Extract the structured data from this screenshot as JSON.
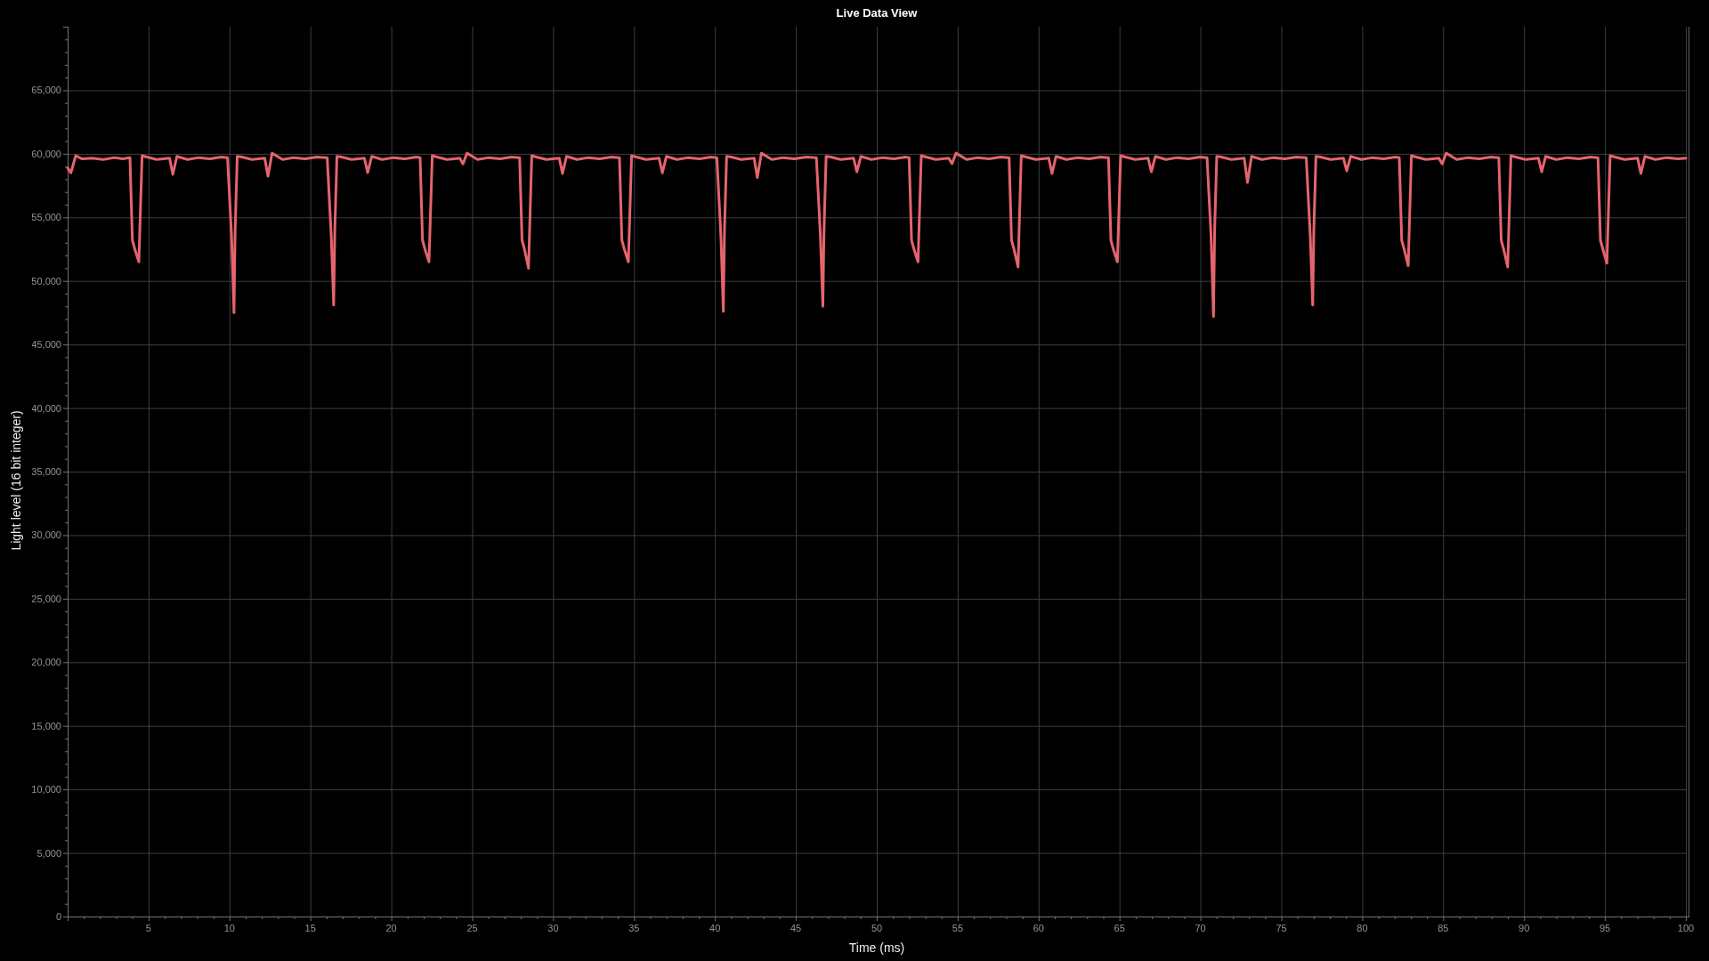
{
  "chart_panel": {
    "chart_data": {
      "type": "line",
      "title": "Live Data View",
      "xlabel": "Time (ms)",
      "ylabel": "Light level (16 bit integer)",
      "grid": true,
      "x": [
        0,
        0.2,
        0.5,
        0.9,
        1.5,
        2.2,
        2.9,
        3.4,
        3.85,
        4,
        4.15,
        4.4,
        4.6,
        4.9,
        5.5,
        6.3,
        6.5,
        6.75,
        7.4,
        8.1,
        8.8,
        9.5,
        9.88,
        10.13,
        10.28,
        10.35,
        10.48,
        10.78,
        11.38,
        12.18,
        12.38,
        12.63,
        13.28,
        13.98,
        14.68,
        15.38,
        16.04,
        16.29,
        16.44,
        16.51,
        16.64,
        16.94,
        17.54,
        18.34,
        18.54,
        18.79,
        19.44,
        20.14,
        20.84,
        21.54,
        21.78,
        21.93,
        22.08,
        22.33,
        22.53,
        22.83,
        23.43,
        24.23,
        24.43,
        24.68,
        25.33,
        26.03,
        26.73,
        27.43,
        27.93,
        28.08,
        28.23,
        28.48,
        28.68,
        28.98,
        29.58,
        30.38,
        30.58,
        30.83,
        31.48,
        32.18,
        32.88,
        33.58,
        34.1,
        34.25,
        34.4,
        34.65,
        34.85,
        35.15,
        35.75,
        36.55,
        36.75,
        37,
        37.65,
        38.35,
        39.05,
        39.75,
        40.12,
        40.37,
        40.52,
        40.59,
        40.72,
        41.02,
        41.62,
        42.42,
        42.62,
        42.87,
        43.52,
        44.22,
        44.92,
        45.62,
        46.27,
        46.52,
        46.67,
        46.74,
        46.87,
        47.17,
        47.77,
        48.57,
        48.77,
        49.02,
        49.67,
        50.37,
        51.07,
        51.77,
        52,
        52.15,
        52.3,
        52.55,
        52.75,
        53.05,
        53.65,
        54.45,
        54.65,
        54.9,
        55.55,
        56.25,
        56.95,
        57.65,
        58.18,
        58.33,
        58.48,
        58.73,
        58.93,
        59.23,
        59.83,
        60.63,
        60.83,
        61.08,
        61.73,
        62.43,
        63.13,
        63.83,
        64.32,
        64.47,
        64.62,
        64.87,
        65.07,
        65.37,
        65.97,
        66.77,
        66.97,
        67.22,
        67.87,
        68.57,
        69.27,
        69.97,
        70.41,
        70.66,
        70.81,
        70.88,
        71.01,
        71.31,
        71.91,
        72.71,
        72.91,
        73.16,
        73.81,
        74.51,
        75.21,
        75.91,
        76.54,
        76.79,
        76.94,
        77.01,
        77.14,
        77.44,
        78.04,
        78.84,
        79.04,
        79.29,
        79.94,
        80.64,
        81.34,
        82.04,
        82.29,
        82.44,
        82.59,
        82.84,
        83.04,
        83.34,
        83.94,
        84.74,
        84.94,
        85.19,
        85.84,
        86.54,
        87.24,
        87.94,
        88.44,
        88.59,
        88.74,
        88.99,
        89.19,
        89.49,
        90.09,
        90.89,
        91.09,
        91.34,
        91.99,
        92.69,
        93.39,
        94.09,
        94.57,
        94.72,
        94.87,
        95.12,
        95.32,
        95.62,
        96.22,
        97.02,
        97.22,
        97.47,
        98.12,
        98.82,
        99.52,
        100
      ],
      "series": [
        {
          "color": "#e5646e",
          "values": [
            58900,
            58500,
            59850,
            59600,
            59650,
            59550,
            59700,
            59600,
            59700,
            53200,
            52500,
            51500,
            59850,
            59750,
            59550,
            59650,
            58380,
            59800,
            59550,
            59700,
            59600,
            59750,
            59700,
            53500,
            47500,
            54000,
            59800,
            59750,
            59550,
            59650,
            58240,
            60050,
            59550,
            59700,
            59600,
            59750,
            59700,
            53500,
            48100,
            54000,
            59800,
            59750,
            59550,
            59650,
            58520,
            59800,
            59550,
            59700,
            59600,
            59750,
            59700,
            53200,
            52500,
            51500,
            59850,
            59750,
            59550,
            59650,
            59200,
            60050,
            59550,
            59700,
            59600,
            59750,
            59700,
            53200,
            52500,
            51000,
            59850,
            59750,
            59550,
            59650,
            58450,
            59800,
            59550,
            59700,
            59600,
            59750,
            59700,
            53200,
            52500,
            51500,
            59850,
            59750,
            59550,
            59650,
            58500,
            59800,
            59550,
            59700,
            59600,
            59750,
            59700,
            53500,
            47600,
            54000,
            59800,
            59750,
            59550,
            59650,
            58130,
            60050,
            59550,
            59700,
            59600,
            59750,
            59700,
            53500,
            48000,
            54000,
            59800,
            59750,
            59550,
            59650,
            58590,
            59800,
            59550,
            59700,
            59600,
            59750,
            59700,
            53200,
            52500,
            51500,
            59850,
            59750,
            59550,
            59650,
            59220,
            60050,
            59550,
            59700,
            59600,
            59750,
            59700,
            53200,
            52500,
            51100,
            59850,
            59750,
            59550,
            59650,
            58450,
            59800,
            59550,
            59700,
            59600,
            59750,
            59700,
            53200,
            52500,
            51500,
            59850,
            59750,
            59550,
            59650,
            58590,
            59800,
            59550,
            59700,
            59600,
            59750,
            59700,
            53500,
            47200,
            54000,
            59800,
            59750,
            59550,
            59650,
            57750,
            59800,
            59550,
            59700,
            59600,
            59750,
            59700,
            53500,
            48100,
            54000,
            59800,
            59750,
            59550,
            59650,
            58660,
            59800,
            59550,
            59700,
            59600,
            59750,
            59700,
            53200,
            52500,
            51200,
            59850,
            59750,
            59550,
            59650,
            59200,
            60050,
            59550,
            59700,
            59600,
            59750,
            59700,
            53200,
            52500,
            51100,
            59850,
            59750,
            59550,
            59650,
            58590,
            59800,
            59550,
            59700,
            59600,
            59750,
            59700,
            53200,
            52500,
            51400,
            59850,
            59750,
            59550,
            59650,
            58450,
            59800,
            59550,
            59700,
            59600,
            59650
          ]
        }
      ],
      "xlim": [
        0,
        100
      ],
      "ylim": [
        0,
        70000
      ],
      "xticks": [
        {
          "value": 5,
          "label": "5"
        },
        {
          "value": 10,
          "label": "10"
        },
        {
          "value": 15,
          "label": "15"
        },
        {
          "value": 20,
          "label": "20"
        },
        {
          "value": 25,
          "label": "25"
        },
        {
          "value": 30,
          "label": "30"
        },
        {
          "value": 35,
          "label": "35"
        },
        {
          "value": 40,
          "label": "40"
        },
        {
          "value": 45,
          "label": "45"
        },
        {
          "value": 50,
          "label": "50"
        },
        {
          "value": 55,
          "label": "55"
        },
        {
          "value": 60,
          "label": "60"
        },
        {
          "value": 65,
          "label": "65"
        },
        {
          "value": 70,
          "label": "70"
        },
        {
          "value": 75,
          "label": "75"
        },
        {
          "value": 80,
          "label": "80"
        },
        {
          "value": 85,
          "label": "85"
        },
        {
          "value": 90,
          "label": "90"
        },
        {
          "value": 95,
          "label": "95"
        },
        {
          "value": 100,
          "label": "100"
        }
      ],
      "yticks": [
        {
          "value": 0,
          "label": "0"
        },
        {
          "value": 5000,
          "label": "5,000"
        },
        {
          "value": 10000,
          "label": "10,000"
        },
        {
          "value": 15000,
          "label": "15,000"
        },
        {
          "value": 20000,
          "label": "20,000"
        },
        {
          "value": 25000,
          "label": "25,000"
        },
        {
          "value": 30000,
          "label": "30,000"
        },
        {
          "value": 35000,
          "label": "35,000"
        },
        {
          "value": 40000,
          "label": "40,000"
        },
        {
          "value": 45000,
          "label": "45,000"
        },
        {
          "value": 50000,
          "label": "50,000"
        },
        {
          "value": 55000,
          "label": "55,000"
        },
        {
          "value": 60000,
          "label": "60,000"
        },
        {
          "value": 65000,
          "label": "65,000"
        }
      ]
    }
  }
}
